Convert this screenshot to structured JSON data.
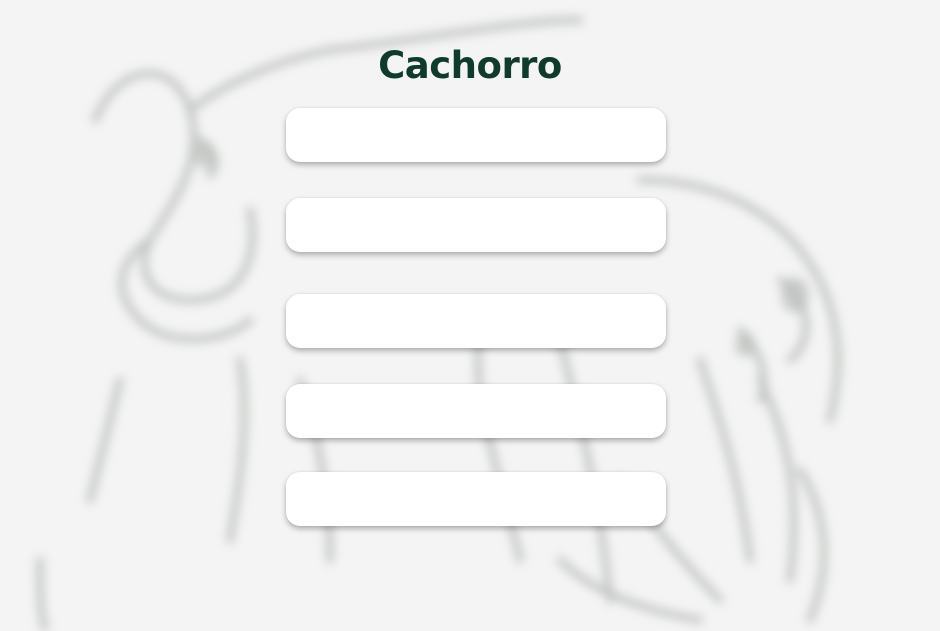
{
  "quiz": {
    "title": "Cachorro",
    "options": [
      {
        "label": ""
      },
      {
        "label": ""
      },
      {
        "label": ""
      },
      {
        "label": ""
      },
      {
        "label": ""
      }
    ]
  },
  "colors": {
    "title": "#0f3a2c",
    "option_bg": "#ffffff",
    "background": "#f3f4f3"
  },
  "background": {
    "icon": "dog-sketch-illustration"
  }
}
